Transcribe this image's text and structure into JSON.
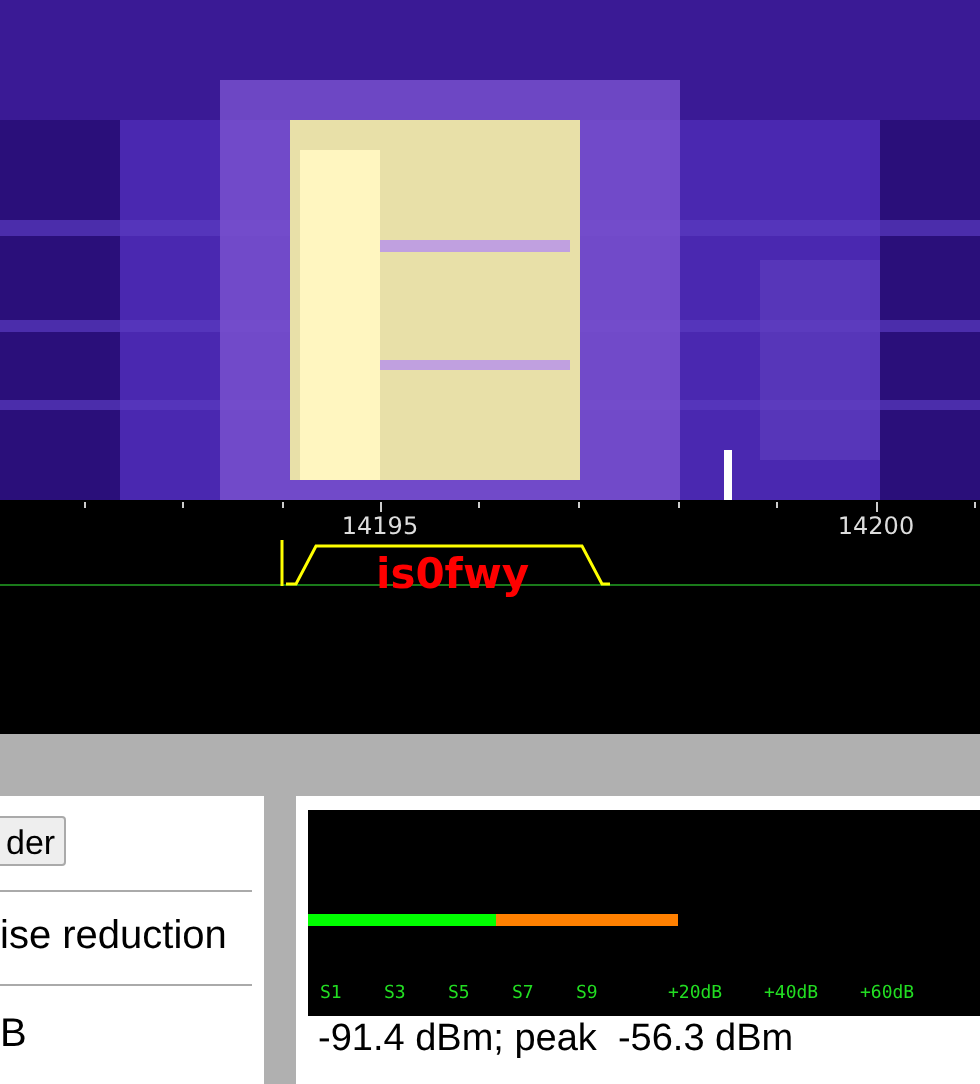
{
  "frequency_scale": {
    "labels": [
      "14195",
      "14200"
    ]
  },
  "station_label": "is0fwy",
  "left_panel": {
    "button": "der",
    "option": "ise reduction",
    "value": "B"
  },
  "smeter": {
    "segments": [
      {
        "level": 0.28,
        "color": "#00ff00"
      },
      {
        "level": 0.55,
        "color": "#ff8000"
      }
    ],
    "scale": [
      "S1",
      "S3",
      "S5",
      "S7",
      "S9",
      "+20dB",
      "+40dB",
      "+60dB"
    ],
    "reading": "-91.4 dBm; peak  -56.3 dBm"
  }
}
